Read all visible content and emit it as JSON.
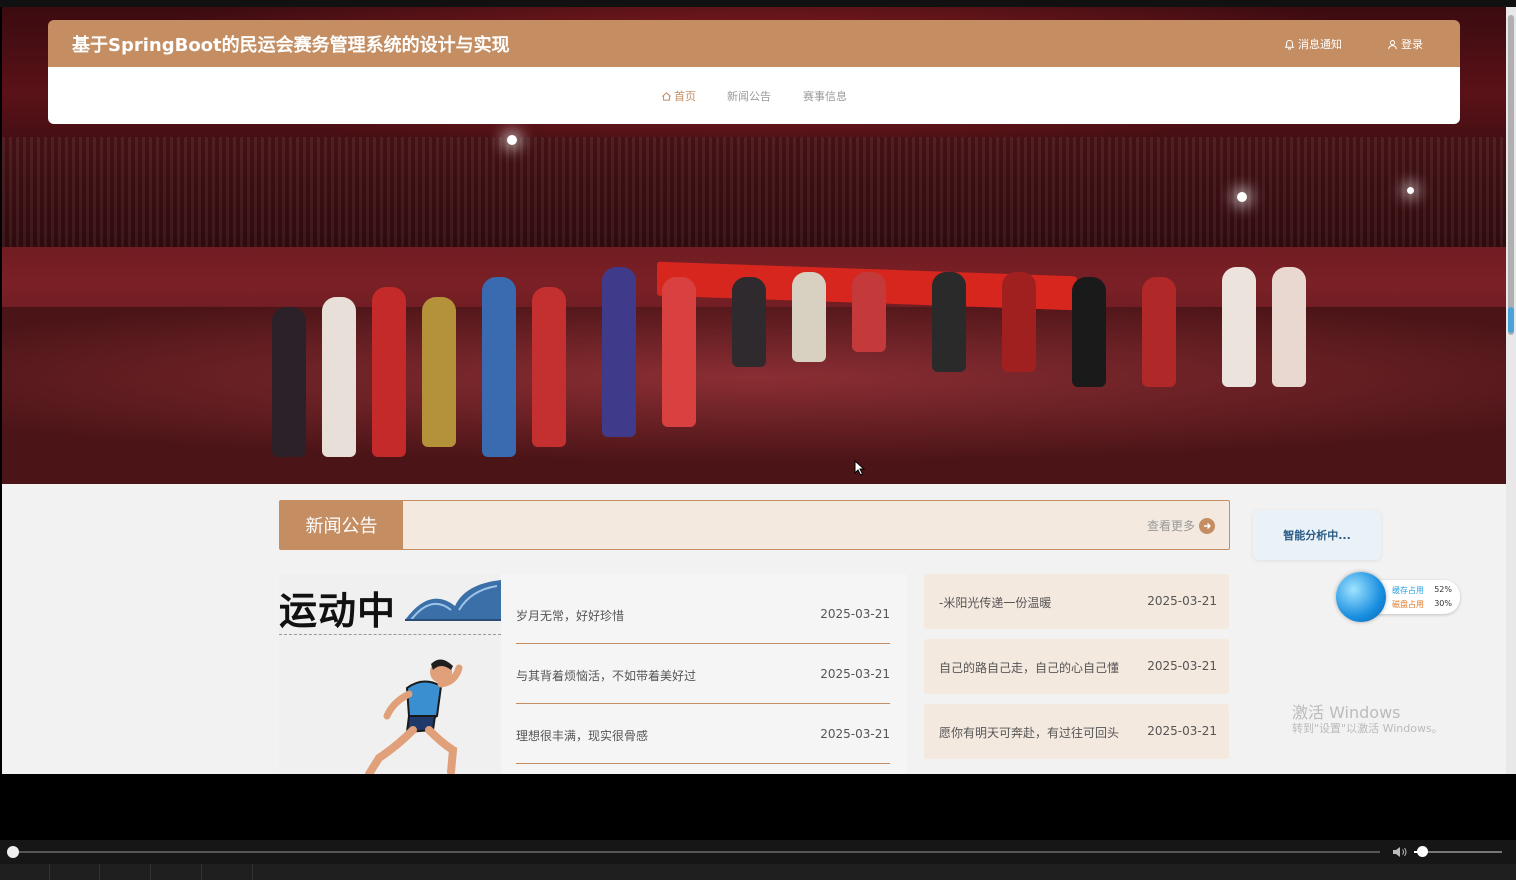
{
  "header": {
    "site_title": "基于SpringBoot的民运会赛务管理系统的设计与实现",
    "notify_label": "消息通知",
    "login_label": "登录"
  },
  "nav": {
    "items": [
      {
        "label": "首页",
        "active": true
      },
      {
        "label": "新闻公告",
        "active": false
      },
      {
        "label": "赛事信息",
        "active": false
      }
    ]
  },
  "news": {
    "section_title": "新闻公告",
    "more_label": "查看更多",
    "feature_text": "运动中",
    "left_items": [
      {
        "title": "岁月无常，好好珍惜",
        "date": "2025-03-21"
      },
      {
        "title": "与其背着烦恼活，不如带着美好过",
        "date": "2025-03-21"
      },
      {
        "title": "理想很丰满，现实很骨感",
        "date": "2025-03-21"
      }
    ],
    "right_items": [
      {
        "title": "-米阳光传递一份温暖",
        "date": "2025-03-21"
      },
      {
        "title": "自己的路自己走，自己的心自己懂",
        "date": "2025-03-21"
      },
      {
        "title": "愿你有明天可奔赴，有过往可回头",
        "date": "2025-03-21"
      }
    ]
  },
  "widgets": {
    "ai_label": "智能分析中...",
    "mem_label": "缓存占用",
    "mem_value": "52%",
    "disk_label": "磁盘占用",
    "disk_value": "30%"
  },
  "watermark": {
    "line1": "激活 Windows",
    "line2": "转到\"设置\"以激活 Windows。"
  },
  "colors": {
    "accent": "#c48d62",
    "panel": "#f4e9df"
  }
}
